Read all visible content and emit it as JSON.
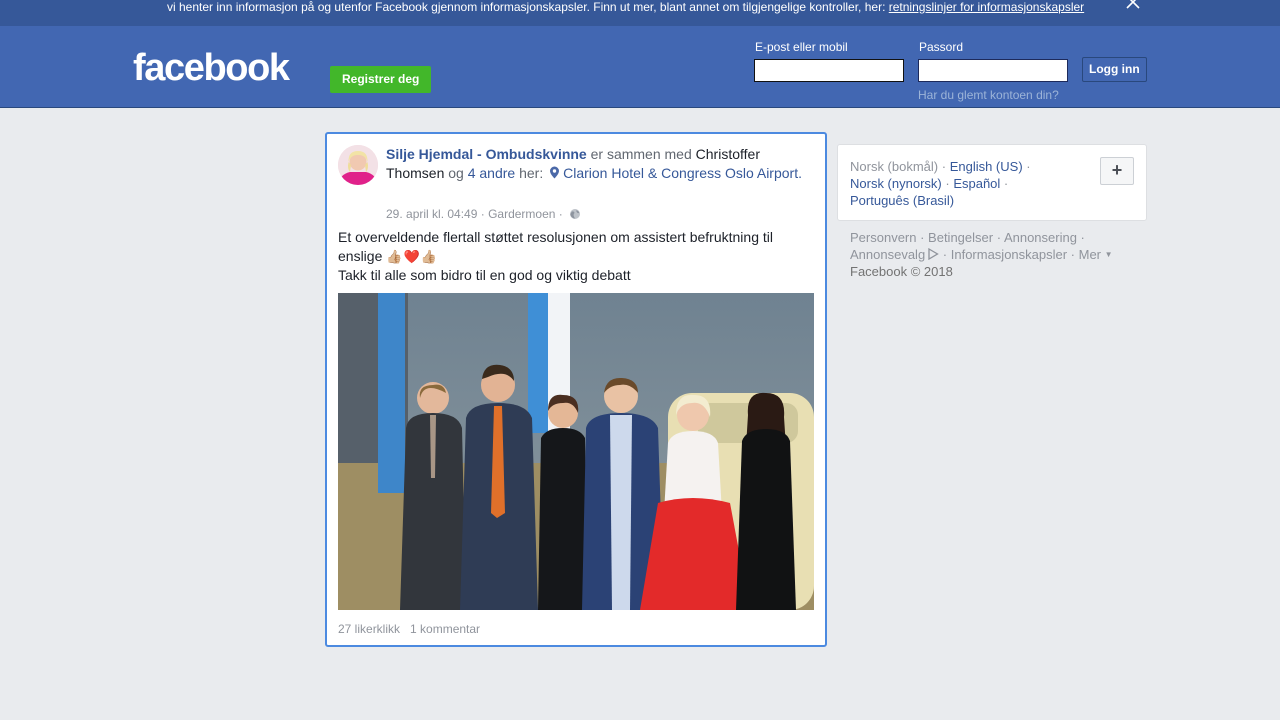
{
  "cookie_banner": {
    "text": "vi henter inn informasjon på og utenfor Facebook gjennom informasjonskapsler. Finn ut mer, blant annet om tilgjengelige kontroller, her: ",
    "link": "retningslinjer for informasjonskapsler",
    "close_icon": "close-icon"
  },
  "header": {
    "logo": "facebook",
    "register_label": "Registrer deg",
    "email_label": "E-post eller mobil",
    "email_value": "",
    "password_label": "Passord",
    "password_value": "",
    "login_label": "Logg inn",
    "forgot_label": "Har du glemt kontoen din?"
  },
  "post": {
    "author": "Silje Hjemdal - Ombudskvinne",
    "with_text": " er sammen med ",
    "tagged_person": "Christoffer Thomsen",
    "and_text": " og ",
    "others": "4 andre",
    "here_text": " her: ",
    "location": "Clarion Hotel & Congress Oslo Airport",
    "date": "29. april kl. 04:49",
    "place": "Gardermoen",
    "text_line1": "Et overveldende flertall støttet resolusjonen om assistert befruktning til enslige",
    "emojis": "👍🏼❤️👍🏼",
    "text_line2": "Takk til alle som bidro til en god og viktig debatt",
    "likes": "27 likerklikk",
    "comments": "1 kommentar",
    "icons": [
      "pin-icon",
      "globe-icon"
    ]
  },
  "languages": {
    "current": "Norsk (bokmål)",
    "options": [
      "English (US)",
      "Norsk (nynorsk)",
      "Español",
      "Português (Brasil)"
    ],
    "add_label": "+"
  },
  "footer": {
    "links": [
      "Personvern",
      "Betingelser",
      "Annonsering",
      "Annonsevalg",
      "Informasjonskapsler",
      "Mer"
    ],
    "copyright": "Facebook © 2018"
  },
  "colors": {
    "brand_blue": "#4267b2",
    "banner_blue": "#365899",
    "register_green": "#42b72a",
    "link_blue": "#365899",
    "page_bg": "#e9ebee"
  }
}
